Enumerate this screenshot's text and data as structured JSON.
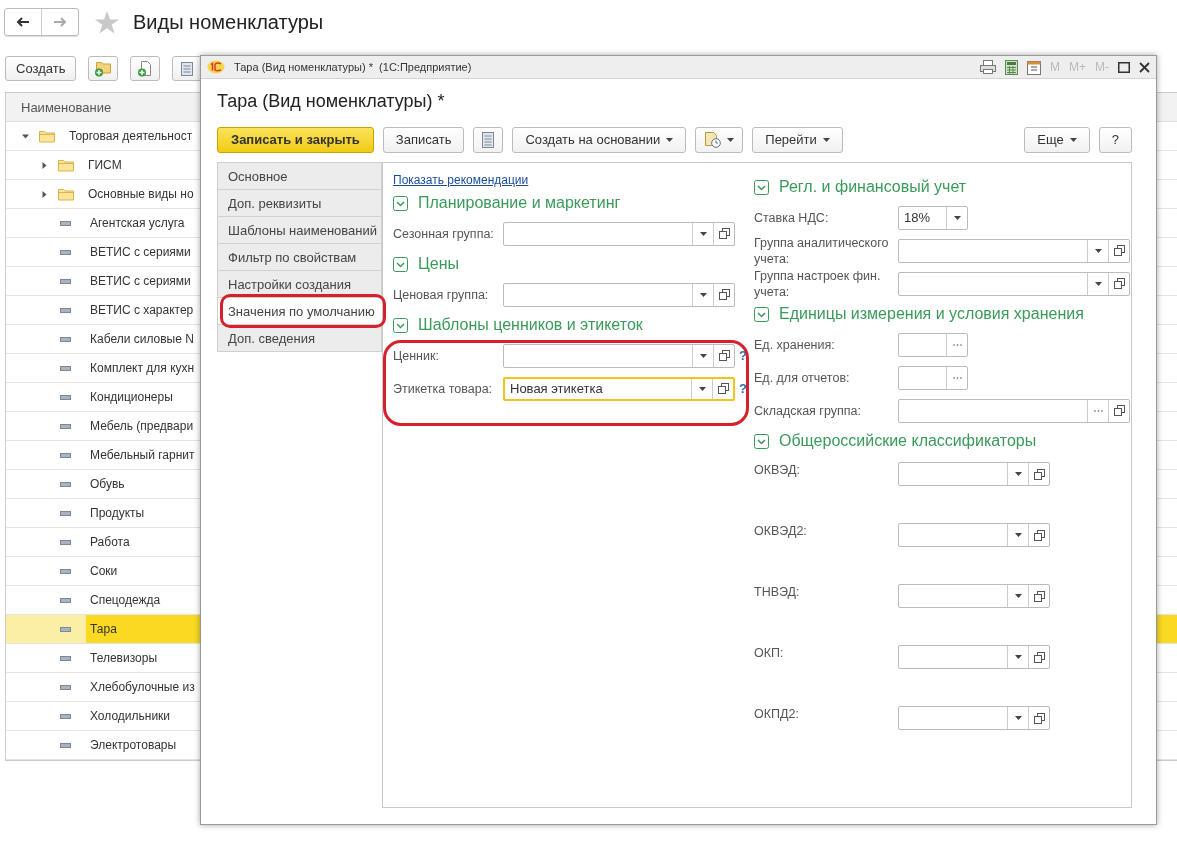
{
  "page": {
    "title": "Виды номенклатуры",
    "create_button": "Создать"
  },
  "list": {
    "column": "Наименование",
    "rows": [
      {
        "label": "Торговая деятельност",
        "kind": "group",
        "expanded": true,
        "selected": false,
        "children": [
          {
            "label": "ГИСМ",
            "kind": "group",
            "expanded": false,
            "selected": false
          },
          {
            "label": "Основные виды но",
            "kind": "group",
            "expanded": false,
            "selected": false
          },
          {
            "label": "Агентская услуга",
            "kind": "item",
            "selected": false
          },
          {
            "label": "ВЕТИС с сериями",
            "kind": "item",
            "selected": false
          },
          {
            "label": "ВЕТИС с сериями",
            "kind": "item",
            "selected": false
          },
          {
            "label": "ВЕТИС с характер",
            "kind": "item",
            "selected": false
          },
          {
            "label": "Кабели силовые N",
            "kind": "item",
            "selected": false
          },
          {
            "label": "Комплект для кухн",
            "kind": "item",
            "selected": false
          },
          {
            "label": "Кондиционеры",
            "kind": "item",
            "selected": false
          },
          {
            "label": "Мебель (предвари",
            "kind": "item",
            "selected": false
          },
          {
            "label": "Мебельный гарнит",
            "kind": "item",
            "selected": false
          },
          {
            "label": "Обувь",
            "kind": "item",
            "selected": false
          },
          {
            "label": "Продукты",
            "kind": "item",
            "selected": false
          },
          {
            "label": "Работа",
            "kind": "item",
            "selected": false
          },
          {
            "label": "Соки",
            "kind": "item",
            "selected": false
          },
          {
            "label": "Спецодежда",
            "kind": "item",
            "selected": false
          },
          {
            "label": "Тара",
            "kind": "item",
            "selected": true
          },
          {
            "label": "Телевизоры",
            "kind": "item",
            "selected": false
          },
          {
            "label": "Хлебобулочные из",
            "kind": "item",
            "selected": false
          },
          {
            "label": "Холодильники",
            "kind": "item",
            "selected": false
          },
          {
            "label": "Электротовары",
            "kind": "item",
            "selected": false
          }
        ]
      }
    ]
  },
  "dialog": {
    "window_title": "Тара (Вид номенклатуры) *  (1С:Предприятие)",
    "memory_buttons": [
      {
        "label": "M",
        "disabled": true
      },
      {
        "label": "M+",
        "disabled": true
      },
      {
        "label": "M-",
        "disabled": true
      }
    ],
    "title": "Тара (Вид номенклатуры) *",
    "toolbar": [
      {
        "kind": "primary",
        "label": "Записать и закрыть"
      },
      {
        "kind": "text",
        "label": "Записать"
      },
      {
        "kind": "list-icon"
      },
      {
        "kind": "menu",
        "label": "Создать на основании"
      },
      {
        "kind": "icon-menu"
      },
      {
        "kind": "menu",
        "label": "Перейти"
      }
    ],
    "toolbar_right": [
      {
        "kind": "menu",
        "label": "Еще"
      },
      {
        "kind": "text",
        "label": "?"
      }
    ],
    "tabs": [
      {
        "label": "Основное",
        "selected": false
      },
      {
        "label": "Доп. реквизиты",
        "selected": false
      },
      {
        "label": "Шаблоны наименований",
        "selected": false
      },
      {
        "label": "Фильтр по свойствам",
        "selected": false
      },
      {
        "label": "Настройки создания",
        "selected": false
      },
      {
        "label": "Значения по умолчанию",
        "selected": true
      },
      {
        "label": "Доп. сведения",
        "selected": false
      }
    ],
    "link": "Показать рекомендации",
    "left_sections": [
      {
        "heading": "Планирование и маркетинг",
        "expanded": true,
        "kind": "normal",
        "fields": [
          {
            "label": "Сезонная группа:",
            "kind": "combo"
          }
        ]
      },
      {
        "heading": "Цены",
        "expanded": true,
        "kind": "normal",
        "fields": [
          {
            "label": "Ценовая группа:",
            "kind": "combo"
          }
        ]
      },
      {
        "heading": "Шаблоны ценников и этикеток",
        "expanded": true,
        "kind": "normal",
        "fields": [
          {
            "label": "Ценник:",
            "kind": "combo",
            "help": "?"
          },
          {
            "label": "Этикетка товара:",
            "value": "Новая этикетка",
            "kind": "combo",
            "help": "?",
            "focused": true
          }
        ]
      }
    ],
    "right_sections": [
      {
        "heading": "Регл. и финансовый учет",
        "expanded": true,
        "kind": "normal",
        "fields": [
          {
            "label": "Ставка НДС:",
            "value": "18%",
            "kind": "dropdown"
          },
          {
            "label": "Группа аналитического учета:",
            "kind": "combo"
          },
          {
            "label": "Группа настроек фин. учета:",
            "kind": "combo"
          }
        ]
      },
      {
        "heading": "Единицы измерения и условия хранения",
        "expanded": true,
        "kind": "normal",
        "fields": [
          {
            "label": "Ед. хранения:",
            "kind": "choice"
          },
          {
            "label": "Ед. для отчетов:",
            "kind": "choice"
          },
          {
            "label": "Складская группа:",
            "kind": "choice-open"
          }
        ]
      },
      {
        "heading": "Общероссийские классификаторы",
        "expanded": true,
        "kind": "classifier",
        "fields": [
          {
            "label": "ОКВЭД:",
            "kind": "combo"
          },
          {
            "label": "ОКВЭД2:",
            "kind": "combo"
          },
          {
            "label": "ТНВЭД:",
            "kind": "combo"
          },
          {
            "label": "ОКП:",
            "kind": "combo"
          },
          {
            "label": "ОКПД2:",
            "kind": "combo"
          }
        ]
      }
    ]
  }
}
